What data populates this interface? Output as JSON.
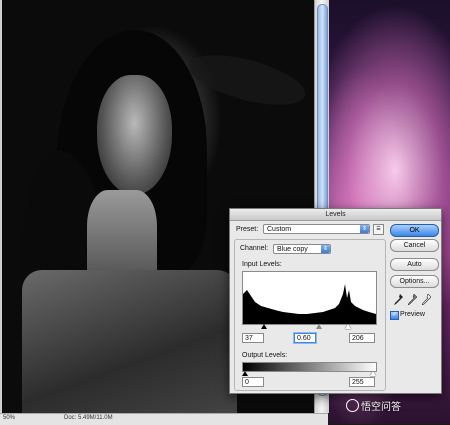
{
  "status_bar": {
    "zoom": "50%",
    "doc_info": "Doc: 5.49M/11.0M"
  },
  "dialog": {
    "title": "Levels",
    "preset_label": "Preset:",
    "preset_value": "Custom",
    "channel_label": "Channel:",
    "channel_value": "Blue copy",
    "input_levels_label": "Input Levels:",
    "input_black": "37",
    "input_gamma": "0.60",
    "input_white": "206",
    "output_levels_label": "Output Levels:",
    "output_black": "0",
    "output_white": "255",
    "buttons": {
      "ok": "OK",
      "cancel": "Cancel",
      "auto": "Auto",
      "options": "Options..."
    },
    "preview_label": "Preview",
    "preview_checked": true
  },
  "watermark": "悟空问答"
}
